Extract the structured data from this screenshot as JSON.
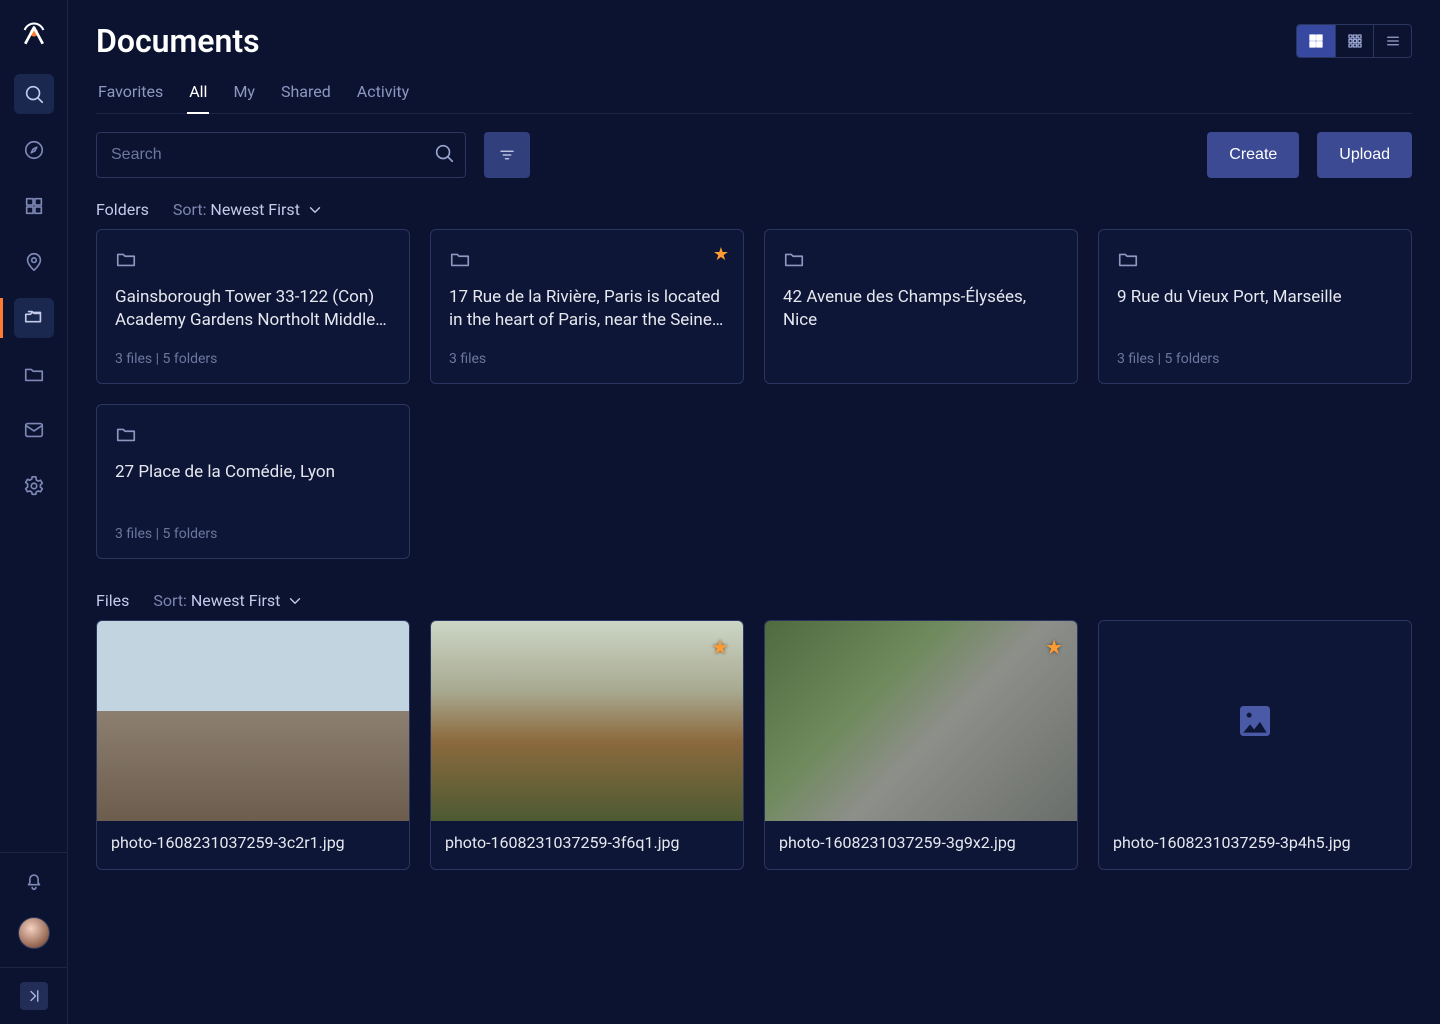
{
  "page": {
    "title": "Documents"
  },
  "tabs": [
    {
      "label": "Favorites",
      "active": false
    },
    {
      "label": "All",
      "active": true
    },
    {
      "label": "My",
      "active": false
    },
    {
      "label": "Shared",
      "active": false
    },
    {
      "label": "Activity",
      "active": false
    }
  ],
  "search": {
    "placeholder": "Search",
    "value": ""
  },
  "actions": {
    "create": "Create",
    "upload": "Upload"
  },
  "view_modes": [
    "grid-large",
    "grid-small",
    "list"
  ],
  "view_mode_active": "grid-large",
  "folders_section": {
    "label": "Folders",
    "sort_label": "Sort:",
    "sort_value": "Newest First"
  },
  "folders": [
    {
      "title": "Gainsborough Tower 33-122 (Con) Academy Gardens Northolt Middle…",
      "meta": "3 files | 5 folders",
      "starred": false
    },
    {
      "title": "17 Rue de la Rivière, Paris is located in the heart of Paris, near the Seine…",
      "meta": "3 files",
      "starred": true
    },
    {
      "title": "42 Avenue des Champs-Élysées, Nice",
      "meta": "",
      "starred": false
    },
    {
      "title": "9 Rue du Vieux Port, Marseille",
      "meta": "3 files | 5 folders",
      "starred": false
    },
    {
      "title": "27 Place de la Comédie, Lyon",
      "meta": "3 files | 5 folders",
      "starred": false
    }
  ],
  "files_section": {
    "label": "Files",
    "sort_label": "Sort:",
    "sort_value": "Newest First"
  },
  "files": [
    {
      "name": "photo-1608231037259-3c2r1.jpg",
      "starred": false,
      "thumb": "ph1"
    },
    {
      "name": "photo-1608231037259-3f6q1.jpg",
      "starred": true,
      "thumb": "ph2"
    },
    {
      "name": "photo-1608231037259-3g9x2.jpg",
      "starred": true,
      "thumb": "ph3"
    },
    {
      "name": "photo-1608231037259-3p4h5.jpg",
      "starred": false,
      "thumb": "placeholder"
    }
  ]
}
